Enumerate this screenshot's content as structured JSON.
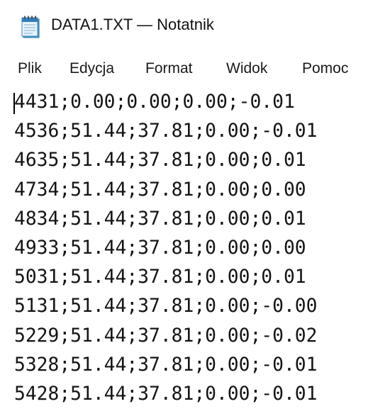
{
  "window": {
    "title": "DATA1.TXT — Notatnik",
    "icon": "notepad-icon"
  },
  "menu": {
    "items": [
      {
        "label": "Plik"
      },
      {
        "label": "Edycja"
      },
      {
        "label": "Format"
      },
      {
        "label": "Widok"
      },
      {
        "label": "Pomoc"
      }
    ]
  },
  "editor": {
    "lines": [
      "4431;0.00;0.00;0.00;-0.01",
      "4536;51.44;37.81;0.00;-0.01",
      "4635;51.44;37.81;0.00;0.01",
      "4734;51.44;37.81;0.00;0.00",
      "4834;51.44;37.81;0.00;0.01",
      "4933;51.44;37.81;0.00;0.00",
      "5031;51.44;37.81;0.00;0.01",
      "5131;51.44;37.81;0.00;-0.00",
      "5229;51.44;37.81;0.00;-0.02",
      "5328;51.44;37.81;0.00;-0.01",
      "5428;51.44;37.81;0.00;-0.01"
    ]
  }
}
